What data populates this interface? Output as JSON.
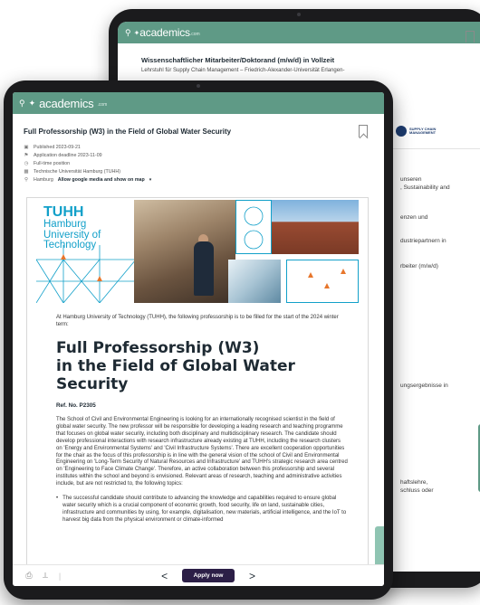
{
  "back_tablet": {
    "logo": "academics",
    "logo_suffix": ".com",
    "job_title": "Wissenschaftlicher Mitarbeiter/Doktorand (m/w/d) in Vollzeit",
    "employer_line": "Lehrstuhl für Supply Chain Management – Friedrich-Alexander-Universität Erlangen-",
    "employer_logo_text": "SUPPLY CHAIN MANAGEMENT",
    "snippets": [
      "unseren",
      ", Sustainability and",
      "enzen und",
      "dustriepartnern in",
      "rbeiter (m/w/d)",
      "ungsergebnisse in",
      "haftslehre,",
      "schluss oder"
    ]
  },
  "header": {
    "logo": "academics",
    "logo_suffix": ".com"
  },
  "job": {
    "title": "Full Professorship (W3) in the Field of Global Water Security",
    "published": "Published 2023-09-21",
    "deadline": "Application deadline 2023-11-09",
    "position_type": "Full-time position",
    "employer": "Technische Universität Hamburg (TUHH)",
    "location": "Hamburg",
    "location_link": "Allow google media and show on map"
  },
  "document": {
    "brand_line1": "TUHH",
    "brand_line2": "Hamburg",
    "brand_line3": "University of",
    "brand_line4": "Technology",
    "intro": "At Hamburg University of Technology (TUHH), the following professorship is to be filled for the start of the 2024 winter term:",
    "title_line1": "Full Professorship (W3)",
    "title_line2": "in the Field of Global Water Security",
    "ref": "Ref. No. P2305",
    "paragraph": "The School of Civil and Environmental Engineering is looking for an internationally recognised scientist in the field of global water security. The new professor will be responsible for developing a leading research and teaching programme that focuses on global water security, including both disciplinary and multidisciplinary research. The candidate should develop professional interactions with research infrastructure already existing at TUHH, including the research clusters on 'Energy and Environmental Systems' and 'Civil Infrastructure Systems'. There are excellent cooperation opportunities for the chair as the focus of this professorship is in line with the general vision of the school of Civil and Environmental Engineering on 'Long-Term Security of Natural Resources and Infrastructure' and TUHH's strategic research area centred on 'Engineering to Face Climate Change'. Therefore, an active collaboration between this professorship and several institutes within the school and beyond is envisioned. Relevant areas of research, teaching and administrative activities include, but are not restricted to, the following topics:",
    "bullet": "The successful candidate should contribute to advancing the knowledge and capabilities required to ensure global water security which is a crucial component of economic growth, food security, life on land, sustainable cities, infrastructure and communities by using, for example, digitalisation, new materials, artificial intelligence, and the IoT to harvest big data from the physical environment or climate-informed"
  },
  "bottom_bar": {
    "apply_label": "Apply now",
    "prev": "<",
    "next": ">"
  }
}
